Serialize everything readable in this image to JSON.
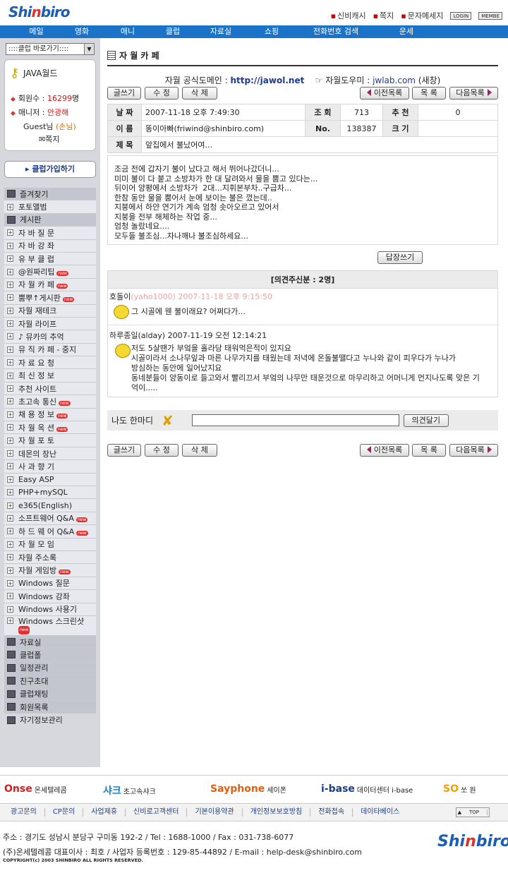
{
  "header": {
    "logo": "Shinbiro",
    "links": [
      "신비캐시",
      "쪽지",
      "문자메세지"
    ],
    "login": "LOGIN",
    "member": "MEMBE"
  },
  "nav": [
    "메일",
    "영화",
    "애니",
    "클럽",
    "자료실",
    "쇼핑",
    "전화번호 검색",
    "운세"
  ],
  "sidebar": {
    "quick": "::::클럽 바로가기::::",
    "club": "JAVA월드",
    "members_label": "회원수 :",
    "members": "16299",
    "members_unit": "명",
    "manager_label": "매니저 :",
    "manager": "안광해",
    "guest": "Guest님",
    "guest_tag": "(손님)",
    "memo": "쪽지",
    "join": "클럽가입하기",
    "items": [
      {
        "label": "즐겨찾기",
        "type": "g"
      },
      {
        "label": "포토앨범",
        "type": "p"
      },
      {
        "label": "게시판",
        "type": "g"
      },
      {
        "label": "자 바 질 문",
        "type": "p"
      },
      {
        "label": "자 바 강 좌",
        "type": "p"
      },
      {
        "label": "유 부 클 럽",
        "type": "p"
      },
      {
        "label": "@원짜리팁",
        "type": "p",
        "new": true
      },
      {
        "label": "자 월 카 페",
        "type": "p",
        "new": true
      },
      {
        "label": "뿜뿌↑게시판",
        "type": "p",
        "new": true
      },
      {
        "label": "자월 재테크",
        "type": "p"
      },
      {
        "label": "자월 라이프",
        "type": "p"
      },
      {
        "label": "♪ 뮤카의 추억",
        "type": "p"
      },
      {
        "label": "뮤 직 카 페 - 중지",
        "type": "p"
      },
      {
        "label": "자 료 요 청",
        "type": "p"
      },
      {
        "label": "최 신 정 보",
        "type": "p"
      },
      {
        "label": "추천 사이트",
        "type": "p"
      },
      {
        "label": "초고속 통신",
        "type": "p",
        "new": true
      },
      {
        "label": "채 용 정 보",
        "type": "p",
        "new": true
      },
      {
        "label": "자 월 옥 션",
        "type": "p",
        "new": true
      },
      {
        "label": "자 월 포 토",
        "type": "p"
      },
      {
        "label": "데몬의 장난",
        "type": "p"
      },
      {
        "label": "사 과 향 기",
        "type": "p"
      },
      {
        "label": "Easy ASP",
        "type": "p"
      },
      {
        "label": "PHP+mySQL",
        "type": "p"
      },
      {
        "label": "e365(English)",
        "type": "p"
      },
      {
        "label": "소프트웨어 Q&A",
        "type": "p",
        "new": true
      },
      {
        "label": "하 드 웨 어 Q&A",
        "type": "p",
        "new": true
      },
      {
        "label": "자 월 모 임",
        "type": "p"
      },
      {
        "label": "자월 주소록",
        "type": "p"
      },
      {
        "label": "자월 게임방",
        "type": "p",
        "new": true
      },
      {
        "label": "Windows 질문",
        "type": "p"
      },
      {
        "label": "Windows 강좌",
        "type": "p"
      },
      {
        "label": "Windows 사용기",
        "type": "p"
      },
      {
        "label": "Windows 스크린샷",
        "type": "p2",
        "new": true
      },
      {
        "label": "자료실",
        "type": "g"
      },
      {
        "label": "클럽폴",
        "type": "g"
      },
      {
        "label": "일정관리",
        "type": "g"
      },
      {
        "label": "친구초대",
        "type": "g"
      },
      {
        "label": "클럽채팅",
        "type": "g"
      },
      {
        "label": "회원목록",
        "type": "g"
      },
      {
        "label": "자기정보관리",
        "type": "w"
      }
    ],
    "new_badge": "new"
  },
  "page": {
    "title": "자 월 카 페",
    "domain_label": "자월 공식도메인 :",
    "domain": "http://jawol.net",
    "help_label": "자월도우미 :",
    "help": "jwlab.com",
    "help_suffix": "(새창)",
    "buttons": {
      "write": "글쓰기",
      "edit": "수 정",
      "delete": "삭 제",
      "prev": "이전목록",
      "list": "목 록",
      "next": "다음목록",
      "reply": "답장쓰기",
      "comment": "의견달기"
    },
    "meta": {
      "date_label": "날 짜",
      "date": "2007-11-18 오후 7:49:30",
      "views_label": "조 회",
      "views": "713",
      "rec_label": "추 천",
      "rec": "0",
      "name_label": "이 름",
      "name": "똥이아빠(friwind@shinbiro.com)",
      "no_label": "No.",
      "no": "138387",
      "size_label": "크 기",
      "size": "",
      "subject_label": "제 목",
      "subject": "앞집에서 불났어여..."
    },
    "body": "조금 전에 갑자기 불이 났다고 해서 뛰어나갔더니...\n미미 불이 다 붙고 소방차가 한 대 달려와서 물을 뿜고 있다는...\n뒤이어 양평에서 소방차가  2대...지휘본부차..구급차...\n한참 동안 물을 뿜어서 눈에 보이는 불은 껐는데..\n지붕에서 하얀 연기가 계속 엄청 솟아오르고 있어서\n지붕을 전부 해체하는 작업 중...\n엄청 놀랐네요....\n모두들 불조심...자나깨나 불조심하세요...",
    "comments_header": "[의견주신분 : 2명]",
    "comments": [
      {
        "author": "호돌이",
        "meta": "(yaho1000) 2007-11-18 오후 9:15:50",
        "text": "그 시골에 웬 불이래요? 어쩌다가..."
      },
      {
        "author": "하루종일(alday) 2007-11-19 오전 12:14:21",
        "meta": "",
        "text": "저도 5살땐가 부엌을 홀라당 태워먹은적이 있지요\n시골이라서 소나무잎과 마른 나무가지를 태웠는데 저녁에 온돌불땔다고 누나와 같이 피우다가 누나가\n방심하는 동안에 일어났지요\n동네분들이 양동이로 들고와서 빨리끄서 부엌의 나무만 태운것으로 마무리하고 어머니게 먼지나도록 맞은 기\n억이....."
      }
    ],
    "reply_label": "나도 한마디"
  },
  "footer": {
    "partners": [
      {
        "name": "Onse",
        "sub": "온세텔레콤",
        "color": "#d02020"
      },
      {
        "name": "샤크",
        "sub": "초고속샤크",
        "color": "#1a7fd0"
      },
      {
        "name": "Sayphone",
        "sub": "세이폰",
        "color": "#e06010"
      },
      {
        "name": "i-base",
        "sub": "데이터센터 i-base",
        "color": "#1a3d8a"
      },
      {
        "name": "SO",
        "sub": "쏘 원",
        "color": "#f0a000"
      }
    ],
    "links": [
      "광고문의",
      "CP문의",
      "사업제휴",
      "신비로고객센터",
      "기본이용약관",
      "개인정보보호방침",
      "전화접속",
      "데이타베이스"
    ],
    "top": "TOP",
    "address": "주소 : 경기도 성남시 분당구 구미동 192-2 / Tel : 1688-1000 / Fax : 031-738-6077",
    "company": "(주)온세텔레콤 대표이사 : 최호 / 사업자 등록번호 : 129-85-44892 / E-mail : help-desk@shinbiro.com",
    "copyright": "COPYRIGHT(c) 2003 SHINBIRO ALL RIGHTS RESERVED."
  }
}
